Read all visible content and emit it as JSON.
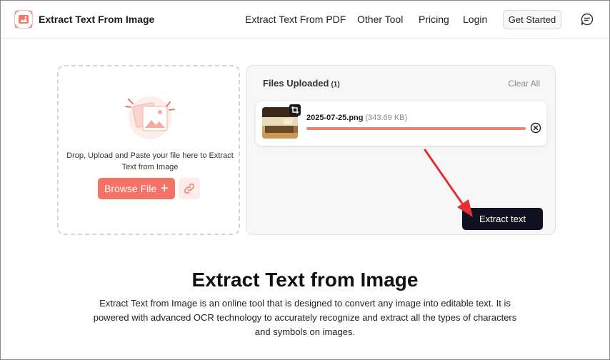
{
  "header": {
    "brand": "Extract Text From Image",
    "nav": [
      "Extract Text From PDF",
      "Other Tool",
      "Pricing",
      "Login"
    ],
    "get_started": "Get Started"
  },
  "upload": {
    "instructions": "Drop, Upload and Paste your file here to Extract Text from Image",
    "browse_label": "Browse File",
    "browse_plus": "+"
  },
  "files": {
    "title": "Files Uploaded",
    "count": "(1)",
    "clear_all": "Clear All",
    "items": [
      {
        "name": "2025-07-25.png",
        "size": "(343.69 KB)",
        "progress": 1.0
      }
    ],
    "extract_button": "Extract text"
  },
  "main": {
    "title": "Extract Text from Image",
    "description": "Extract Text from Image is an online tool that is designed to convert any image into editable text. It is powered with advanced OCR technology to accurately recognize and extract all the types of characters and symbols on images."
  },
  "colors": {
    "accent": "#f37366",
    "dark_button": "#0f1020",
    "annotation_arrow": "#e53030"
  }
}
